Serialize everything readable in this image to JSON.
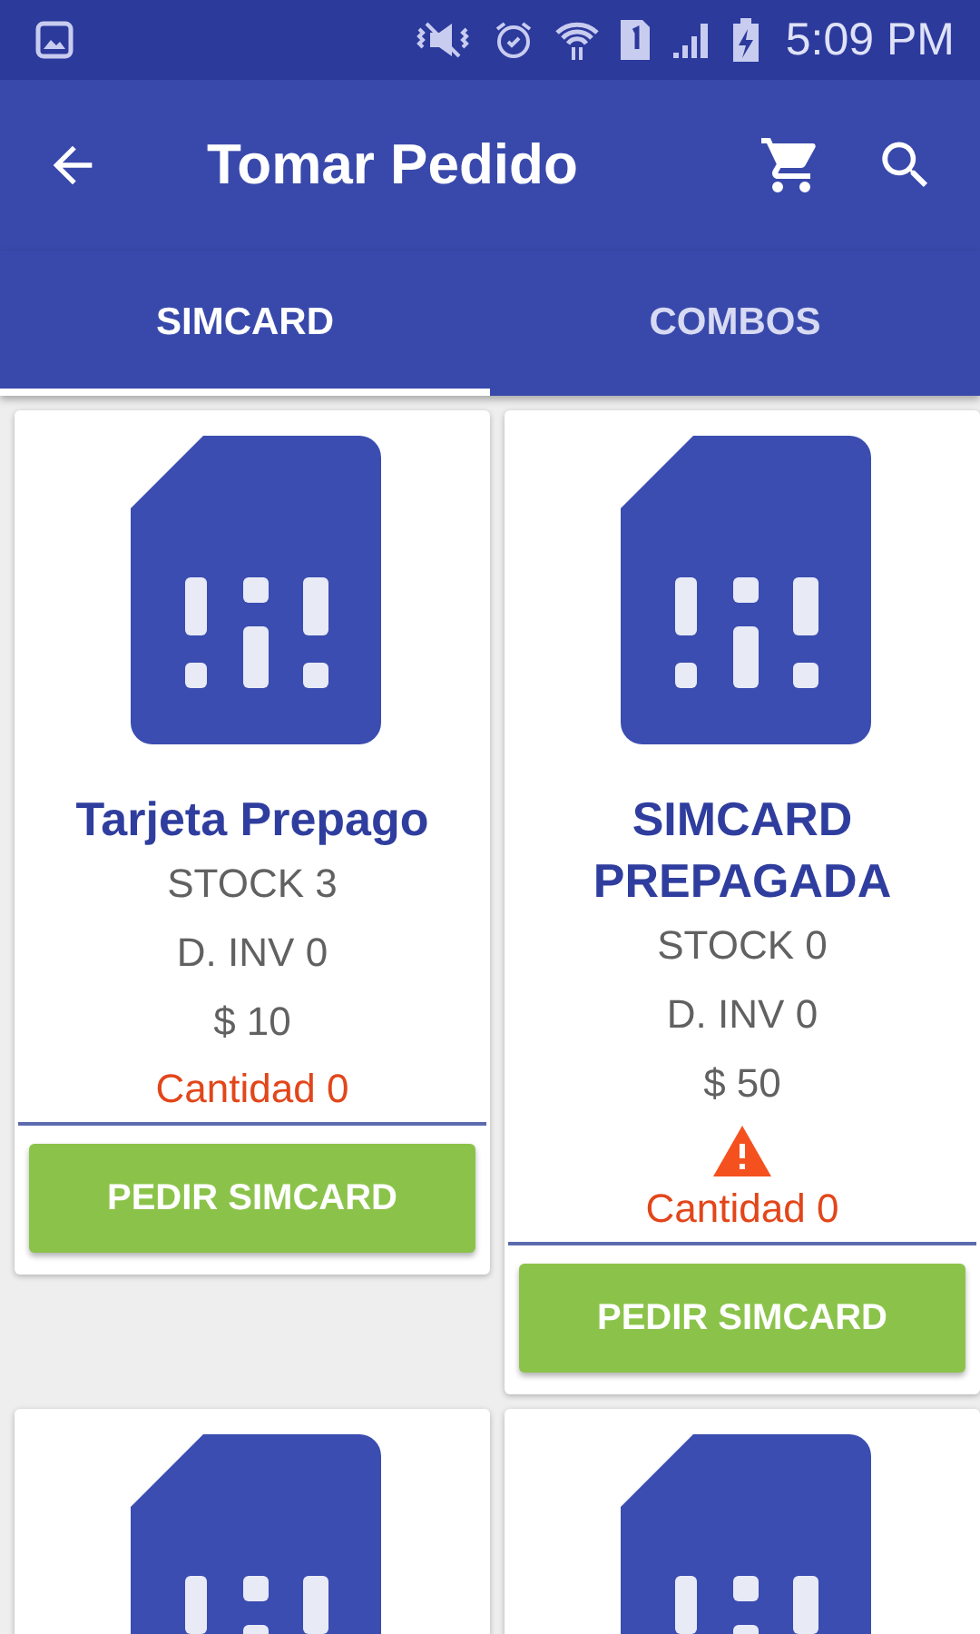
{
  "status_bar": {
    "time": "5:09 PM"
  },
  "app_bar": {
    "title": "Tomar Pedido"
  },
  "tabs": [
    {
      "label": "SIMCARD",
      "selected": true
    },
    {
      "label": "COMBOS",
      "selected": false
    }
  ],
  "products": [
    {
      "kind": "full",
      "name": "Tarjeta Prepago",
      "stock": "STOCK  3",
      "inv": "D. INV 0",
      "price": "$ 10",
      "warning": false,
      "quantity": "Cantidad 0",
      "button": "PEDIR SIMCARD"
    },
    {
      "kind": "full",
      "name": "SIMCARD PREPAGADA",
      "stock": "STOCK  0",
      "inv": "D. INV 0",
      "price": "$ 50",
      "warning": true,
      "quantity": "Cantidad 0",
      "button": "PEDIR SIMCARD"
    },
    {
      "kind": "partial"
    },
    {
      "kind": "partial"
    }
  ]
}
